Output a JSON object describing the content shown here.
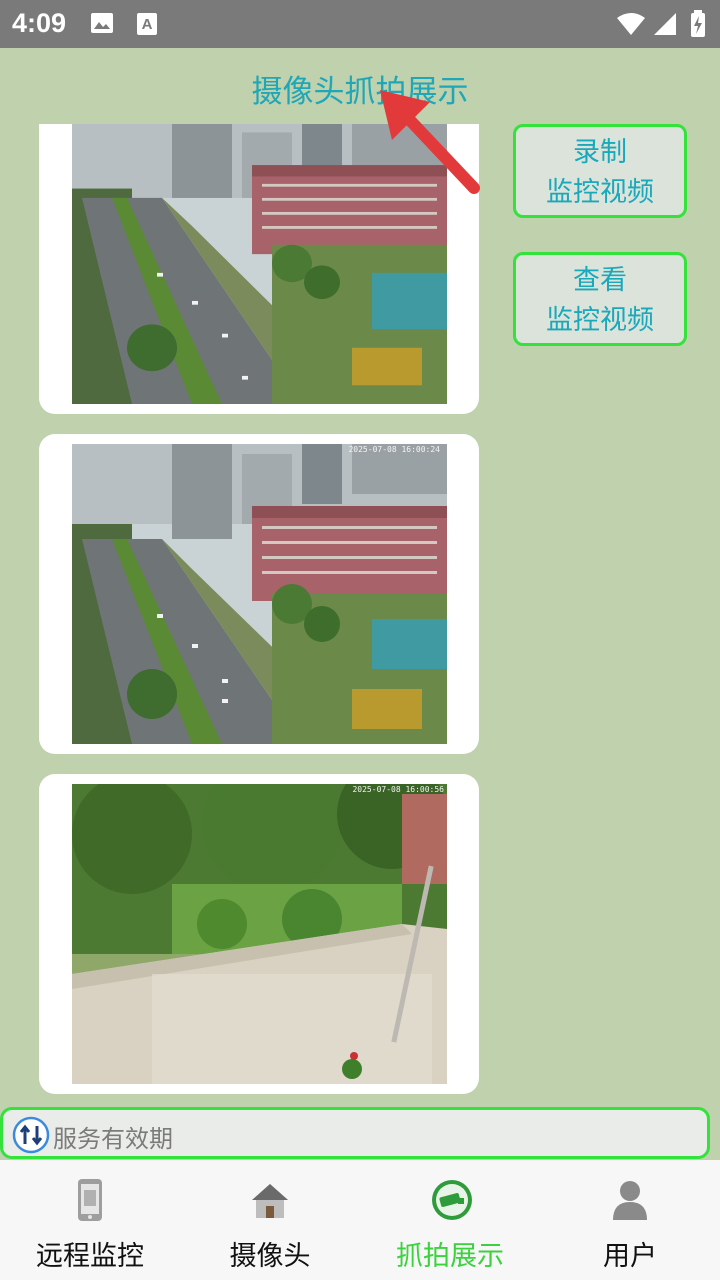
{
  "status_bar": {
    "time": "4:09"
  },
  "header": {
    "title": "摄像头抓拍展示"
  },
  "side_buttons": [
    {
      "line1": "录制",
      "line2": "监控视频"
    },
    {
      "line1": "查看",
      "line2": "监控视频"
    }
  ],
  "snapshots": [
    {
      "kind": "street-view"
    },
    {
      "kind": "street-view",
      "overlay_text": "2025-07-08 16:00:24"
    },
    {
      "kind": "yard-view",
      "overlay_text": "2025-07-08 16:00:56"
    }
  ],
  "service_bar": {
    "text": "服务有效期"
  },
  "bottom_nav": {
    "items": [
      {
        "label": "远程监控",
        "icon": "phone-icon"
      },
      {
        "label": "摄像头",
        "icon": "house-icon"
      },
      {
        "label": "抓拍展示",
        "icon": "camera-icon",
        "active": true
      },
      {
        "label": "用户",
        "icon": "user-icon"
      }
    ]
  },
  "colors": {
    "accent": "#1fa7b8",
    "border_green": "#33e23a",
    "active_nav": "#3bd23e",
    "background": "#bfd1ad"
  }
}
